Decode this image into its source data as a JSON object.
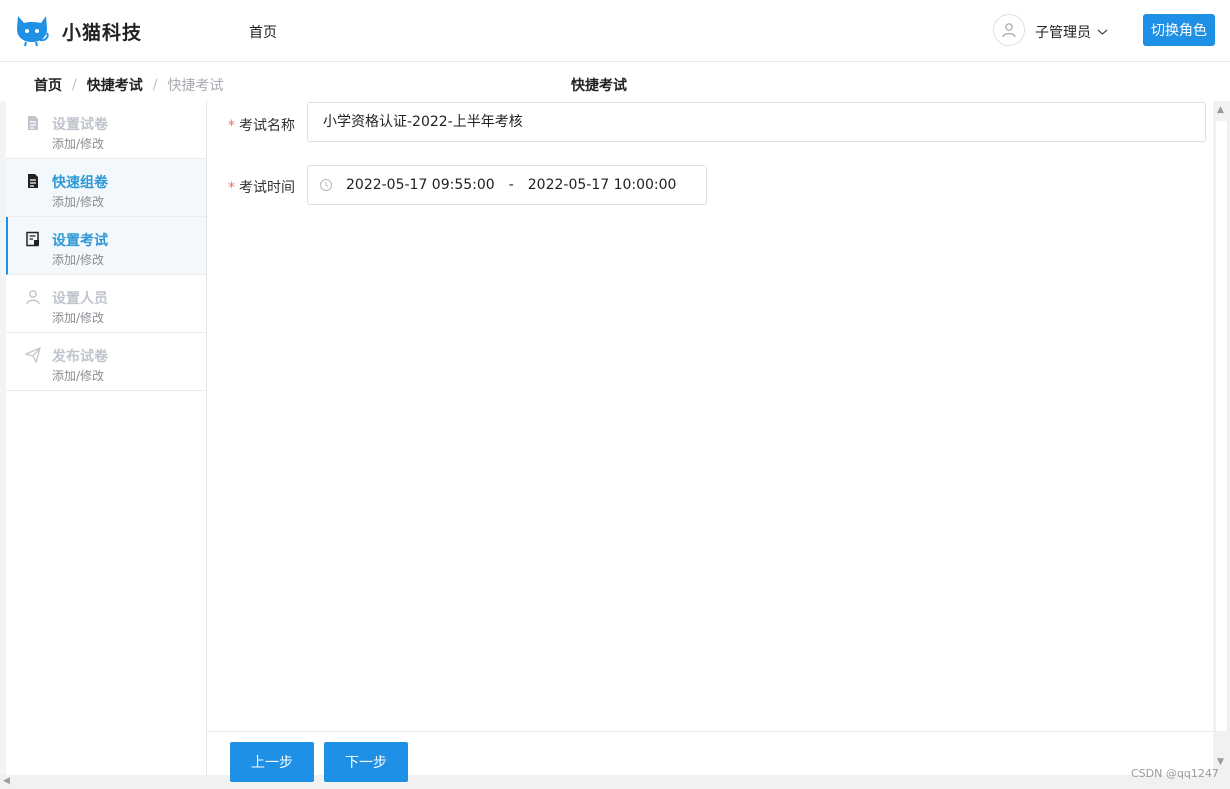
{
  "header": {
    "brand": "小猫科技",
    "nav_home": "首页",
    "user_name": "子管理员",
    "switch_role": "切换角色"
  },
  "breadcrumb": {
    "items": [
      "首页",
      "快捷考试",
      "快捷考试"
    ],
    "separator": "/"
  },
  "page_title": "快捷考试",
  "steps": [
    {
      "title": "设置试卷",
      "sub": "添加/修改",
      "icon": "document-icon",
      "state": "disabled"
    },
    {
      "title": "快速组卷",
      "sub": "添加/修改",
      "icon": "document-icon",
      "state": "done"
    },
    {
      "title": "设置考试",
      "sub": "添加/修改",
      "icon": "exam-setting-icon",
      "state": "active"
    },
    {
      "title": "设置人员",
      "sub": "添加/修改",
      "icon": "person-icon",
      "state": "disabled"
    },
    {
      "title": "发布试卷",
      "sub": "添加/修改",
      "icon": "paper-plane-icon",
      "state": "disabled"
    }
  ],
  "form": {
    "exam_name_label": "考试名称",
    "exam_name_value": "小学资格认证-2022-上半年考核",
    "exam_time_label": "考试时间",
    "exam_time_start": "2022-05-17 09:55:00",
    "exam_time_separator": "-",
    "exam_time_end": "2022-05-17 10:00:00",
    "required_mark": "*"
  },
  "buttons": {
    "prev": "上一步",
    "next": "下一步"
  },
  "watermark": "CSDN @qq1247",
  "colors": {
    "primary": "#1e90e6",
    "active_text": "#2e97d6",
    "required": "#f56c6c"
  }
}
